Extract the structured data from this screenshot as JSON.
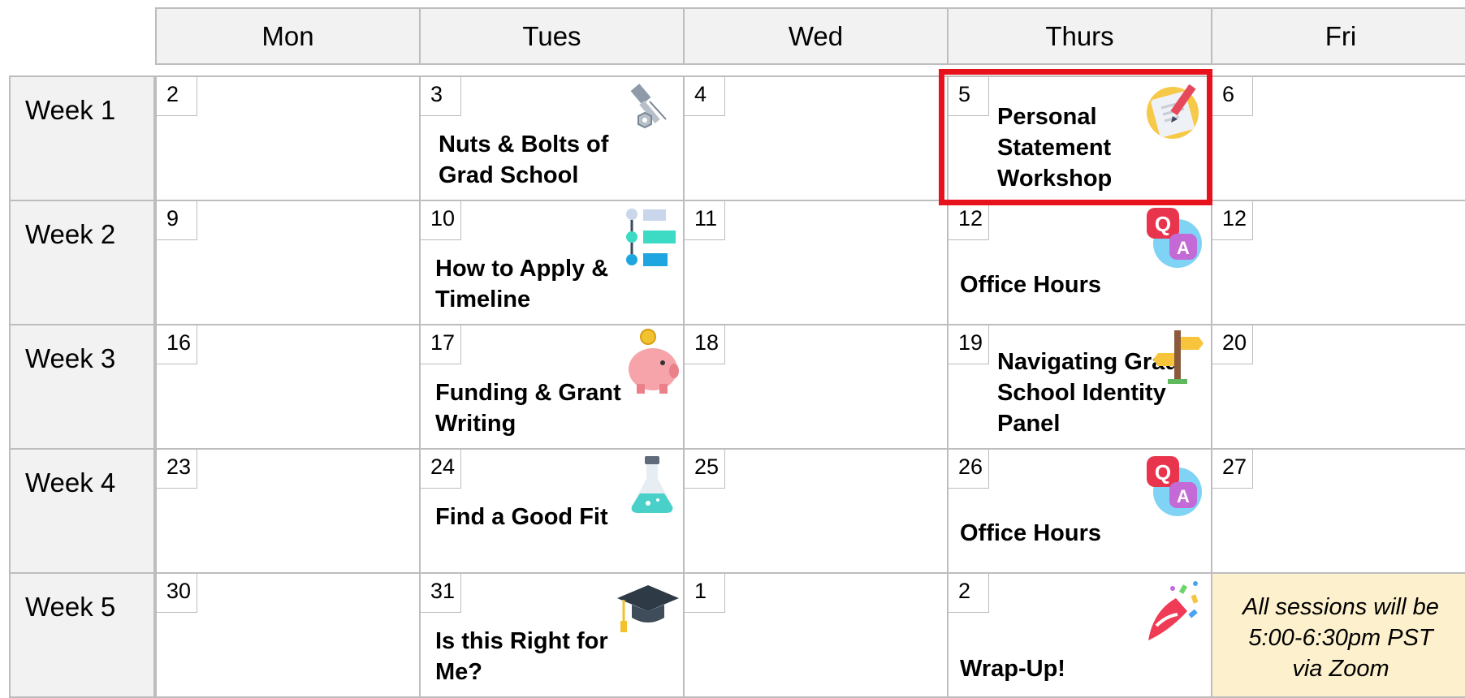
{
  "days": [
    "Mon",
    "Tues",
    "Wed",
    "Thurs",
    "Fri"
  ],
  "weeks": [
    "Week 1",
    "Week 2",
    "Week 3",
    "Week 4",
    "Week 5"
  ],
  "dates": [
    [
      "2",
      "3",
      "4",
      "5",
      "6"
    ],
    [
      "9",
      "10",
      "11",
      "12",
      "12"
    ],
    [
      "16",
      "17",
      "18",
      "19",
      "20"
    ],
    [
      "23",
      "24",
      "25",
      "26",
      "27"
    ],
    [
      "30",
      "31",
      "1",
      "2",
      ""
    ]
  ],
  "events": {
    "w1_tue": "Nuts & Bolts of Grad School",
    "w1_thu": "Personal Statement Workshop",
    "w2_tue": "How to Apply & Timeline",
    "w2_thu": "Office Hours",
    "w3_tue": "Funding & Grant Writing",
    "w3_thu": "Navigating Grad School Identity Panel",
    "w4_tue": "Find a Good Fit",
    "w4_thu": "Office Hours",
    "w5_tue": "Is this Right for Me?",
    "w5_thu": "Wrap-Up!"
  },
  "note": "All sessions will be 5:00-6:30pm PST via Zoom",
  "icons": {
    "w1_tue": "nuts-bolts-icon",
    "w1_thu": "notepad-pencil-icon",
    "w2_tue": "timeline-icon",
    "w2_thu": "qa-icon",
    "w3_tue": "piggy-bank-icon",
    "w3_thu": "signpost-icon",
    "w4_tue": "flask-icon",
    "w4_thu": "qa-icon",
    "w5_tue": "graduation-cap-icon",
    "w5_thu": "party-popper-icon"
  },
  "colors": {
    "header_bg": "#f2f2f2",
    "border": "#bdbdbd",
    "highlight": "#e8121c",
    "note_bg": "#fdf0cc"
  }
}
